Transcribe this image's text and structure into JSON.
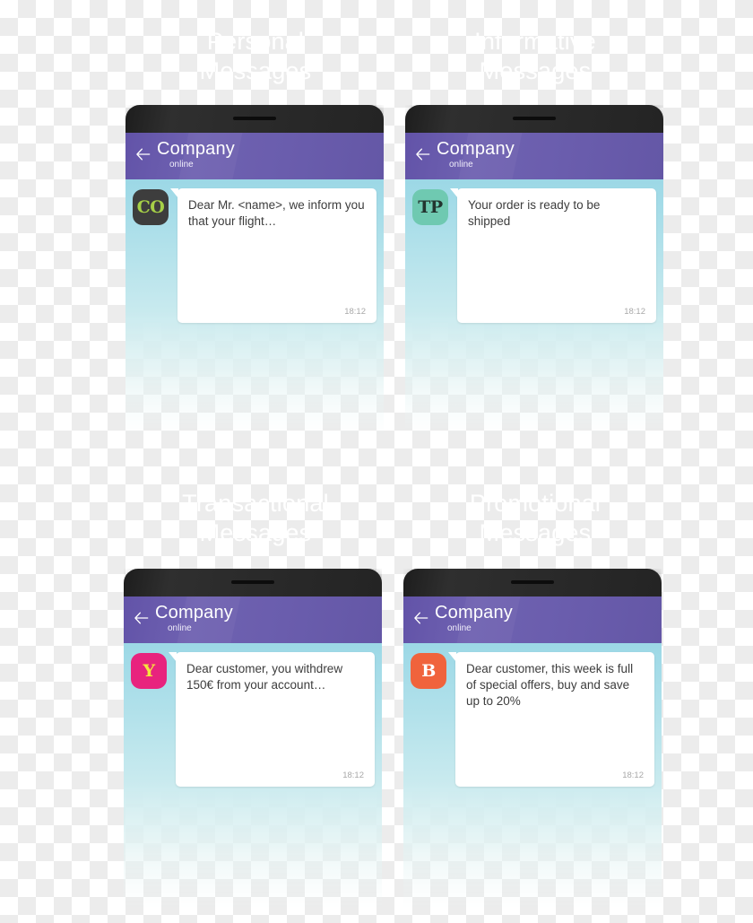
{
  "sections": [
    {
      "id": "personal",
      "title": "Personal\nMessages"
    },
    {
      "id": "informative",
      "title": "Informative\nMessages"
    },
    {
      "id": "transactional",
      "title": "Transactional\nMessages"
    },
    {
      "id": "promotional",
      "title": "Promotional\nMessages"
    }
  ],
  "phones": [
    {
      "id": "personal",
      "header": {
        "back_icon": "back-arrow-icon",
        "title": "Company",
        "status": "online"
      },
      "avatar": {
        "initials": "CO",
        "bg_color": "#3d3d3d",
        "text_color": "#a6d047"
      },
      "message": {
        "text": "Dear Mr. <name>, we inform you that your flight…",
        "time": "18:12"
      }
    },
    {
      "id": "informative",
      "header": {
        "back_icon": "back-arrow-icon",
        "title": "Company",
        "status": "online"
      },
      "avatar": {
        "initials": "TP",
        "bg_color": "#6fc9b1",
        "text_color": "#23342f"
      },
      "message": {
        "text": "Your order is ready to be shipped",
        "time": "18:12"
      }
    },
    {
      "id": "transactional",
      "header": {
        "back_icon": "back-arrow-icon",
        "title": "Company",
        "status": "online"
      },
      "avatar": {
        "initials": "Y",
        "bg_color": "#e8237e",
        "text_color": "#f5e63c"
      },
      "message": {
        "text": "Dear customer, you withdrew 150€ from your account…",
        "time": "18:12"
      }
    },
    {
      "id": "promotional",
      "header": {
        "back_icon": "back-arrow-icon",
        "title": "Company",
        "status": "online"
      },
      "avatar": {
        "initials": "B",
        "bg_color": "#f0633c",
        "text_color": "#ffffff"
      },
      "message": {
        "text": "Dear customer, this week is full of special offers, buy and save up to 20%",
        "time": "18:12"
      }
    }
  ],
  "theme": {
    "header_purple": "#6a5dad",
    "bezel_dark": "#2a2a2a",
    "chat_top": "#9cd8e6",
    "chat_bottom": "#f2fafa",
    "bubble_bg": "#ffffff",
    "bubble_text": "#3c3c3c",
    "timestamp": "#a8a8a8",
    "title_text": "#ffffff"
  }
}
